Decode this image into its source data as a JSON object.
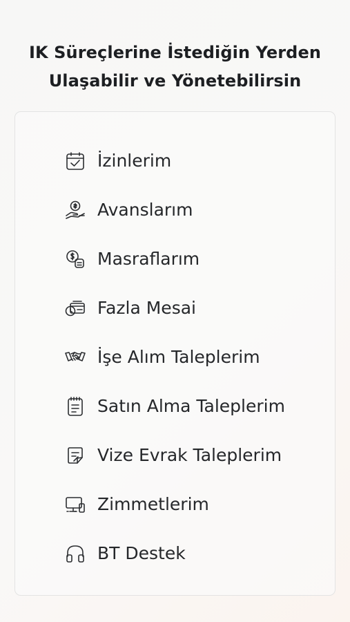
{
  "header": {
    "line1": "IK Süreçlerine İstediğin Yerden",
    "line2": "Ulaşabilir ve Yönetebilirsin"
  },
  "menu": {
    "items": [
      {
        "label": "İzinlerim",
        "icon": "calendar-check-icon"
      },
      {
        "label": "Avanslarım",
        "icon": "hand-coin-icon"
      },
      {
        "label": "Masraflarım",
        "icon": "coin-receipt-icon"
      },
      {
        "label": "Fazla Mesai",
        "icon": "clock-money-icon"
      },
      {
        "label": "İşe Alım Taleplerim",
        "icon": "handshake-icon"
      },
      {
        "label": "Satın Alma Taleplerim",
        "icon": "clipboard-list-icon"
      },
      {
        "label": "Vize Evrak Taleplerim",
        "icon": "document-edit-icon"
      },
      {
        "label": "Zimmetlerim",
        "icon": "monitor-device-icon"
      },
      {
        "label": "BT Destek",
        "icon": "headset-icon"
      }
    ]
  }
}
